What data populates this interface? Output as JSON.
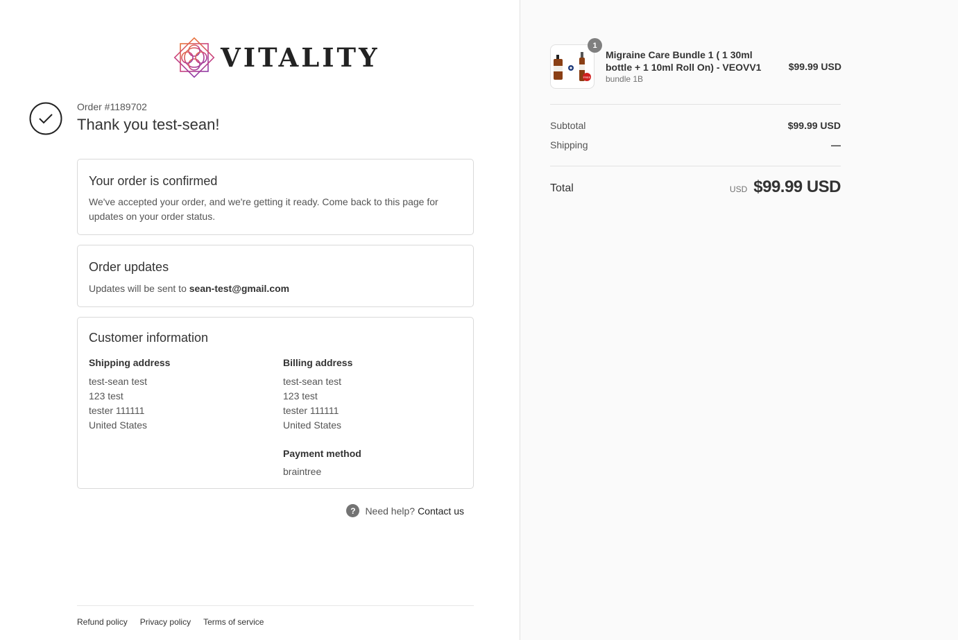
{
  "brand": {
    "name": "VITALITY",
    "colors": {
      "accent_purple": "#8e3aa6",
      "accent_orange": "#e8743b",
      "accent_pink": "#c9417f"
    }
  },
  "header": {
    "order_number": "Order #1189702",
    "thank_you": "Thank you test-sean!"
  },
  "confirmation": {
    "title": "Your order is confirmed",
    "body": "We've accepted your order, and we're getting it ready. Come back to this page for updates on your order status."
  },
  "updates": {
    "title": "Order updates",
    "prefix": "Updates will be sent to ",
    "email": "sean-test@gmail.com"
  },
  "customer": {
    "title": "Customer information",
    "shipping": {
      "heading": "Shipping address",
      "lines": [
        "test-sean test",
        "123 test",
        "tester 111111",
        "United States"
      ]
    },
    "billing": {
      "heading": "Billing address",
      "lines": [
        "test-sean test",
        "123 test",
        "tester 111111",
        "United States"
      ]
    },
    "payment": {
      "heading": "Payment method",
      "value": "braintree"
    }
  },
  "help": {
    "icon": "question-icon",
    "text": "Need help?",
    "link": "Contact us"
  },
  "footer": {
    "links": [
      "Refund policy",
      "Privacy policy",
      "Terms of service"
    ]
  },
  "summary": {
    "product": {
      "quantity": "1",
      "title": "Migraine Care Bundle 1 ( 1 30ml bottle + 1 10ml Roll On) - VEOVV1",
      "variant": "bundle 1B",
      "price": "$99.99 USD"
    },
    "subtotal_label": "Subtotal",
    "subtotal_value": "$99.99 USD",
    "shipping_label": "Shipping",
    "shipping_value": "—",
    "total_label": "Total",
    "total_currency": "USD",
    "total_value": "$99.99 USD"
  }
}
